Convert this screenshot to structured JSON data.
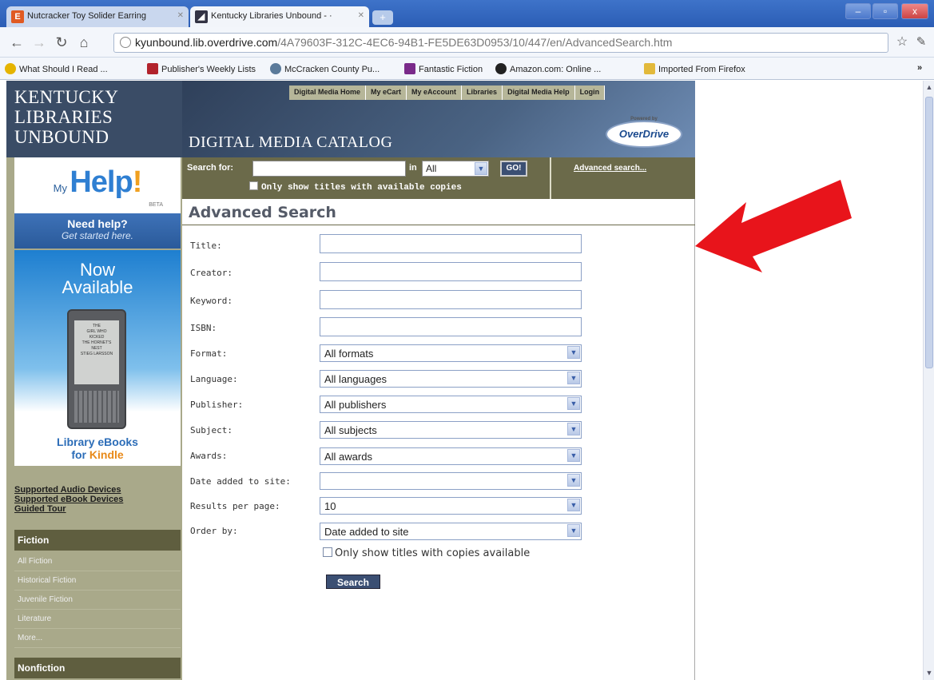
{
  "tabs": [
    {
      "label": "Nutcracker Toy Solider Earring",
      "favicon": "E"
    },
    {
      "label": "Kentucky Libraries Unbound - ·"
    }
  ],
  "new_tab": "+",
  "window_buttons": {
    "minimize": "–",
    "maximize": "▫",
    "close": "x"
  },
  "address": {
    "domain": "kyunbound.lib.overdrive.com",
    "path": "/4A79603F-312C-4EC6-94B1-FE5DE63D0953/10/447/en/AdvancedSearch.htm"
  },
  "bookmarks": [
    {
      "label": "What Should I Read ...",
      "color": "#e5b400"
    },
    {
      "label": "Publisher's Weekly Lists",
      "color": "#b2232c"
    },
    {
      "label": "McCracken County Pu...",
      "color": "#5a7a9a"
    },
    {
      "label": "Fantastic Fiction",
      "color": "#7a2a8a"
    },
    {
      "label": "Amazon.com: Online ...",
      "color": "#222222"
    },
    {
      "label": "Imported From Firefox",
      "color": "#e2b93b"
    }
  ],
  "bookmarks_overflow": "»",
  "site": {
    "brand_line1": "KENTUCKY",
    "brand_line2": "LIBRARIES",
    "brand_line3": "UNBOUND",
    "catalog_title": "DIGITAL MEDIA CATALOG",
    "overdrive": "OverDrive",
    "overdrive_top": "Powered by",
    "topnav": [
      "Digital Media Home",
      "My eCart",
      "My eAccount",
      "Libraries",
      "Digital Media Help",
      "Login"
    ]
  },
  "search": {
    "label": "Search for:",
    "in_label": "in",
    "scope": "All",
    "go": "GO!",
    "only_available": "Only show titles with available copies",
    "advanced_link": "Advanced search..."
  },
  "sidebar": {
    "my": "My",
    "help": "Help",
    "beta": "BETA",
    "need_help": "Need help?",
    "get_started": "Get started here.",
    "now": "Now",
    "available": "Available",
    "kindle_line1": "Library eBooks",
    "kindle_for": "for ",
    "kindle_brand": "Kindle",
    "device_screen": [
      "THE",
      "GIRL WHO",
      "KICKED",
      "THE HORNET'S",
      "NEST",
      "STIEG LARSSON"
    ],
    "links": [
      "Supported Audio Devices",
      "Supported eBook Devices",
      "Guided Tour"
    ],
    "fiction_head": "Fiction",
    "fiction_items": [
      "All Fiction",
      "Historical Fiction",
      "Juvenile Fiction",
      "Literature",
      "More..."
    ],
    "nonfiction_head": "Nonfiction"
  },
  "form": {
    "title": "Advanced Search",
    "fields": [
      {
        "label": "Title:",
        "type": "text",
        "value": ""
      },
      {
        "label": "Creator:",
        "type": "text",
        "value": ""
      },
      {
        "label": "Keyword:",
        "type": "text",
        "value": ""
      },
      {
        "label": "ISBN:",
        "type": "text",
        "value": ""
      },
      {
        "label": "Format:",
        "type": "select",
        "value": "All formats"
      },
      {
        "label": "Language:",
        "type": "select",
        "value": "All languages"
      },
      {
        "label": "Publisher:",
        "type": "select",
        "value": "All publishers"
      },
      {
        "label": "Subject:",
        "type": "select",
        "value": "All subjects"
      },
      {
        "label": "Awards:",
        "type": "select",
        "value": "All awards"
      },
      {
        "label": "Date added to site:",
        "type": "select",
        "value": ""
      },
      {
        "label": "Results per page:",
        "type": "select",
        "value": "10"
      },
      {
        "label": "Order by:",
        "type": "select",
        "value": "Date added to site"
      }
    ],
    "only_available": "Only show titles with copies available",
    "search_button": "Search"
  },
  "colors": {
    "annotation_arrow": "#e8141b"
  }
}
